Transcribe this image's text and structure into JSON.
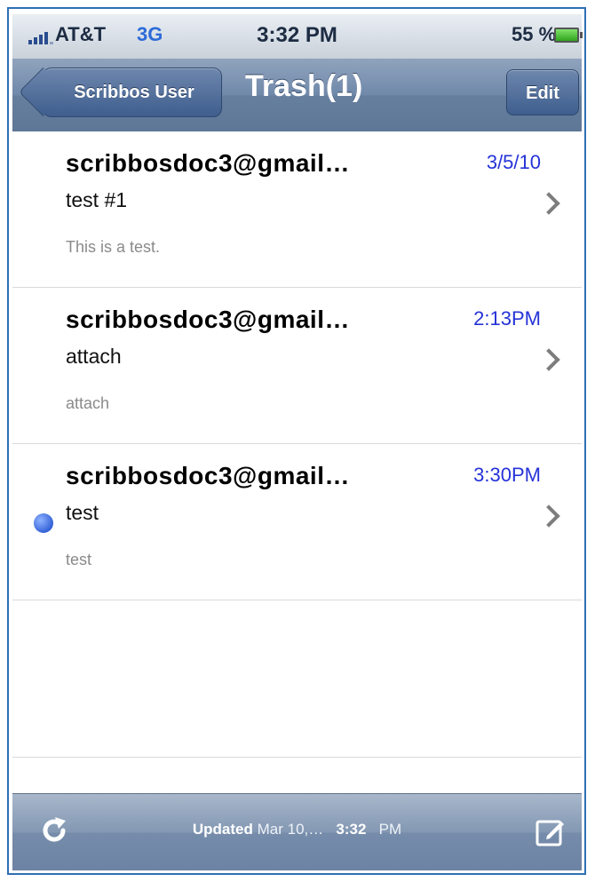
{
  "status_bar": {
    "carrier": "AT&T",
    "network": "3G",
    "time": "3:32 PM",
    "battery": "55 %"
  },
  "nav": {
    "back_label": "Scribbos User",
    "title": "Trash(1)",
    "edit_label": "Edit"
  },
  "messages": [
    {
      "from": "scribbosdoc3@gmail…",
      "date": "3/5/10",
      "subject": "test #1",
      "preview": "This is a test.",
      "unread": false
    },
    {
      "from": "scribbosdoc3@gmail…",
      "date": "2:13PM",
      "subject": "attach",
      "preview": "attach",
      "unread": false
    },
    {
      "from": "scribbosdoc3@gmail…",
      "date": "3:30PM",
      "subject": "test",
      "preview": "test",
      "unread": true
    }
  ],
  "toolbar": {
    "updated_label": "Updated",
    "updated_date": "Mar 10,…",
    "updated_time": "3:32",
    "updated_ampm": "PM",
    "refresh_icon": "refresh-icon",
    "compose_icon": "compose-icon"
  },
  "colors": {
    "date_blue": "#2533d8",
    "unread_dot": "#3563d8",
    "nav_bar": "#6e87a8"
  }
}
